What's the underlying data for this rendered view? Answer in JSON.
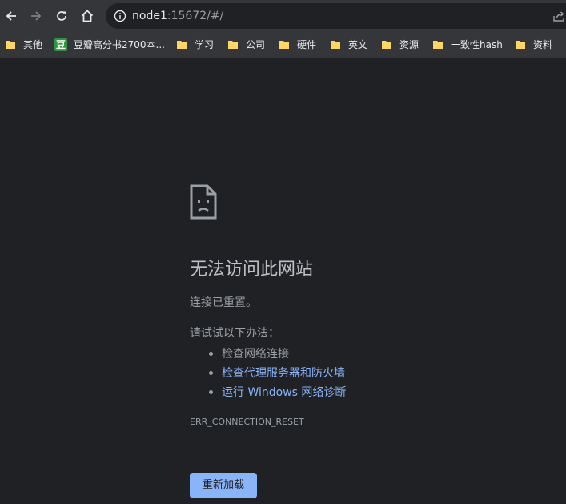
{
  "toolbar": {
    "back_icon": "back-arrow-icon",
    "forward_icon": "forward-arrow-icon",
    "reload_icon": "reload-icon",
    "home_icon": "home-icon",
    "site_info_icon": "info-icon",
    "share_icon": "share-icon",
    "url_host": "node1",
    "url_rest": ":15672/#/"
  },
  "bookmarks": [
    {
      "label": "其他",
      "icon": "folder-icon"
    },
    {
      "label": "豆瓣高分书2700本...",
      "icon": "douban-icon",
      "icon_text": "豆"
    },
    {
      "label": "学习",
      "icon": "folder-icon"
    },
    {
      "label": "公司",
      "icon": "folder-icon"
    },
    {
      "label": "硬件",
      "icon": "folder-icon"
    },
    {
      "label": "英文",
      "icon": "folder-icon"
    },
    {
      "label": "资源",
      "icon": "folder-icon"
    },
    {
      "label": "一致性hash",
      "icon": "folder-icon"
    },
    {
      "label": "资料",
      "icon": "folder-icon"
    }
  ],
  "error": {
    "icon": "sad-page-icon",
    "title": "无法访问此网站",
    "subtitle": "连接已重置。",
    "try_heading": "请试试以下办法：",
    "suggestions": [
      {
        "text": "检查网络连接",
        "is_link": false
      },
      {
        "text": "检查代理服务器和防火墙",
        "is_link": true
      },
      {
        "text": "运行 Windows 网络诊断",
        "is_link": true
      }
    ],
    "code": "ERR_CONNECTION_RESET",
    "reload_label": "重新加载"
  },
  "colors": {
    "page_bg": "#202124",
    "toolbar_bg": "#35363a",
    "link": "#8ab4f8",
    "button_bg": "#8ab4f8",
    "folder": "#fdd663",
    "douban_green": "#2e963d"
  }
}
